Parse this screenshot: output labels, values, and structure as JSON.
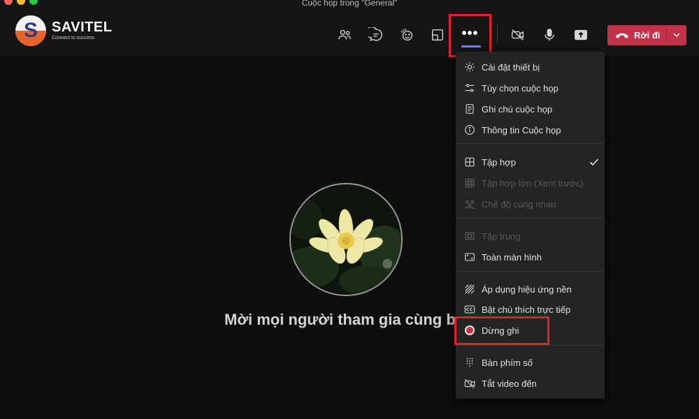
{
  "window": {
    "title": "Cuộc họp trong \"General\"",
    "traffic_lights": [
      "#ff5f57",
      "#febc2e",
      "#28c840"
    ]
  },
  "logo": {
    "letter": "S",
    "name": "SAVITEL",
    "tagline": "Connect to success"
  },
  "toolbar": {
    "icons": [
      "people-icon",
      "chat-icon",
      "reactions-icon",
      "share-tray-icon",
      "more-options-icon",
      "video-off-icon",
      "microphone-icon",
      "share-screen-icon"
    ],
    "more_label": "•••",
    "leave_label": "Rời đi",
    "leave_color": "#c4314b",
    "accent_color": "#7f85f5"
  },
  "stage": {
    "invite_text": "Mời mọi người tham gia cùng b"
  },
  "menu": {
    "items": [
      {
        "label": "Cài đặt thiết bị",
        "icon": "gear-icon"
      },
      {
        "label": "Tùy chọn cuộc họp",
        "icon": "sliders-icon"
      },
      {
        "label": "Ghi chú cuộc họp",
        "icon": "notes-icon"
      },
      {
        "label": "Thông tin Cuộc họp",
        "icon": "info-icon"
      },
      {
        "label": "Tập hợp",
        "icon": "grid-icon"
      },
      {
        "label": "Tập hợp lớn (Xem trước)",
        "icon": "large-grid-icon"
      },
      {
        "label": "Chế độ cùng nhau",
        "icon": "together-icon"
      },
      {
        "label": "Tập trung",
        "icon": "focus-icon"
      },
      {
        "label": "Toàn màn hình",
        "icon": "fullscreen-icon"
      },
      {
        "label": "Áp dụng hiệu ứng nền",
        "icon": "background-effects-icon"
      },
      {
        "label": "Bật chú thích trực tiếp",
        "icon": "captions-icon"
      },
      {
        "label": "Dừng ghi",
        "icon": "record-icon"
      },
      {
        "label": "Bàn phím số",
        "icon": "dialpad-icon"
      },
      {
        "label": "Tắt video đến",
        "icon": "incoming-video-off-icon"
      }
    ],
    "checked_item": "Tập hợp",
    "disabled_items": [
      "Tập hợp lớn (Xem trước)",
      "Chế độ cùng nhau",
      "Tập trung"
    ],
    "record_color": "#c4314b",
    "highlight_color": "#e3202a"
  }
}
